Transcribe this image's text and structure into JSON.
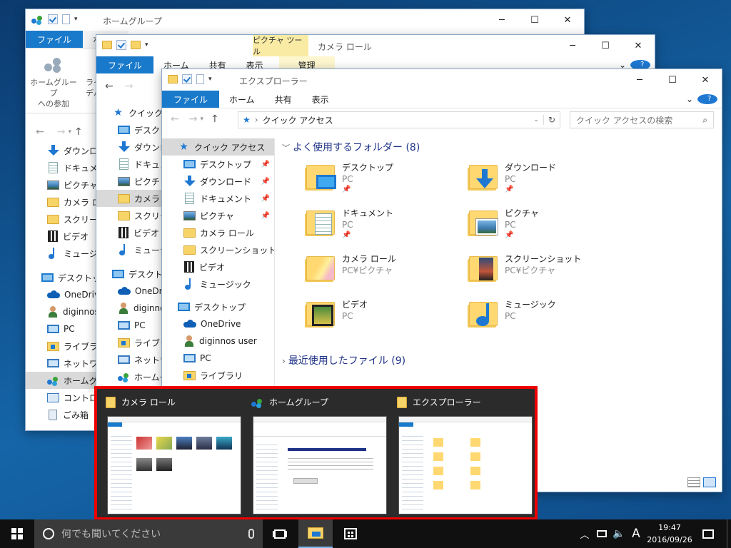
{
  "windows": {
    "homegroup": {
      "title": "ホームグループ",
      "tabs": [
        "ファイル",
        "ホーム"
      ],
      "ribbon": {
        "join_label_line1": "ホームグループ",
        "join_label_line2": "への参加",
        "next_label_line1": "ライ",
        "next_label_line2": "デバ"
      },
      "nav_items": [
        "ダウンロー",
        "ドキュメン",
        "ピクチャ",
        "カメラ ロ",
        "スクリーン",
        "ビデオ",
        "ミュージック",
        "デスクトップ",
        "OneDrive",
        "diginnos",
        "PC",
        "ライブラリ",
        "ネットワー",
        "ホームグル",
        "コントロー",
        "ごみ箱"
      ]
    },
    "camera": {
      "title": "カメラ ロール",
      "tool_header": "ピクチャ ツール",
      "tool_tab": "管理",
      "tabs": [
        "ファイル",
        "ホーム",
        "共有",
        "表示"
      ],
      "nav_items": [
        "クイック アク",
        "デスクトップ",
        "ダウンロー",
        "ドキュメン",
        "ピクチャ",
        "カメラ ロ",
        "スクリーン",
        "ビデオ",
        "ミュージッ",
        "デスクトップ",
        "OneDriv",
        "diginnos",
        "PC",
        "ライブラリ",
        "ネットワー",
        "ホームグル"
      ]
    },
    "explorer": {
      "title": "エクスプローラー",
      "tabs": [
        "ファイル",
        "ホーム",
        "共有",
        "表示"
      ],
      "address": "クイック アクセス",
      "search_placeholder": "クイック アクセスの検索",
      "nav_items": [
        "クイック アクセス",
        "デスクトップ",
        "ダウンロード",
        "ドキュメント",
        "ピクチャ",
        "カメラ ロール",
        "スクリーンショット",
        "ビデオ",
        "ミュージック",
        "デスクトップ",
        "OneDrive",
        "diginnos user",
        "PC",
        "ライブラリ"
      ],
      "frequent_header": "よく使用するフォルダー (8)",
      "recent_header": "最近使用したファイル (9)",
      "folders": [
        {
          "name": "デスクトップ",
          "sub": "PC",
          "pinned": true
        },
        {
          "name": "ダウンロード",
          "sub": "PC",
          "pinned": true
        },
        {
          "name": "ドキュメント",
          "sub": "PC",
          "pinned": true
        },
        {
          "name": "ピクチャ",
          "sub": "PC",
          "pinned": true
        },
        {
          "name": "カメラ ロール",
          "sub": "PC¥ピクチャ",
          "pinned": false
        },
        {
          "name": "スクリーンショット",
          "sub": "PC¥ピクチャ",
          "pinned": false
        },
        {
          "name": "ビデオ",
          "sub": "PC",
          "pinned": false
        },
        {
          "name": "ミュージック",
          "sub": "PC",
          "pinned": false
        }
      ]
    }
  },
  "thumbnails": [
    {
      "title": "カメラ ロール",
      "icon": "folder-icon"
    },
    {
      "title": "ホームグループ",
      "icon": "homegroup-icon"
    },
    {
      "title": "エクスプローラー",
      "icon": "explorer-icon"
    }
  ],
  "taskbar": {
    "search_placeholder": "何でも聞いてください",
    "ime": "A",
    "time": "19:47",
    "date": "2016/09/26"
  },
  "colors": {
    "accent": "#1979ca",
    "highlight_border": "#e00000",
    "taskbar": "#101010"
  }
}
